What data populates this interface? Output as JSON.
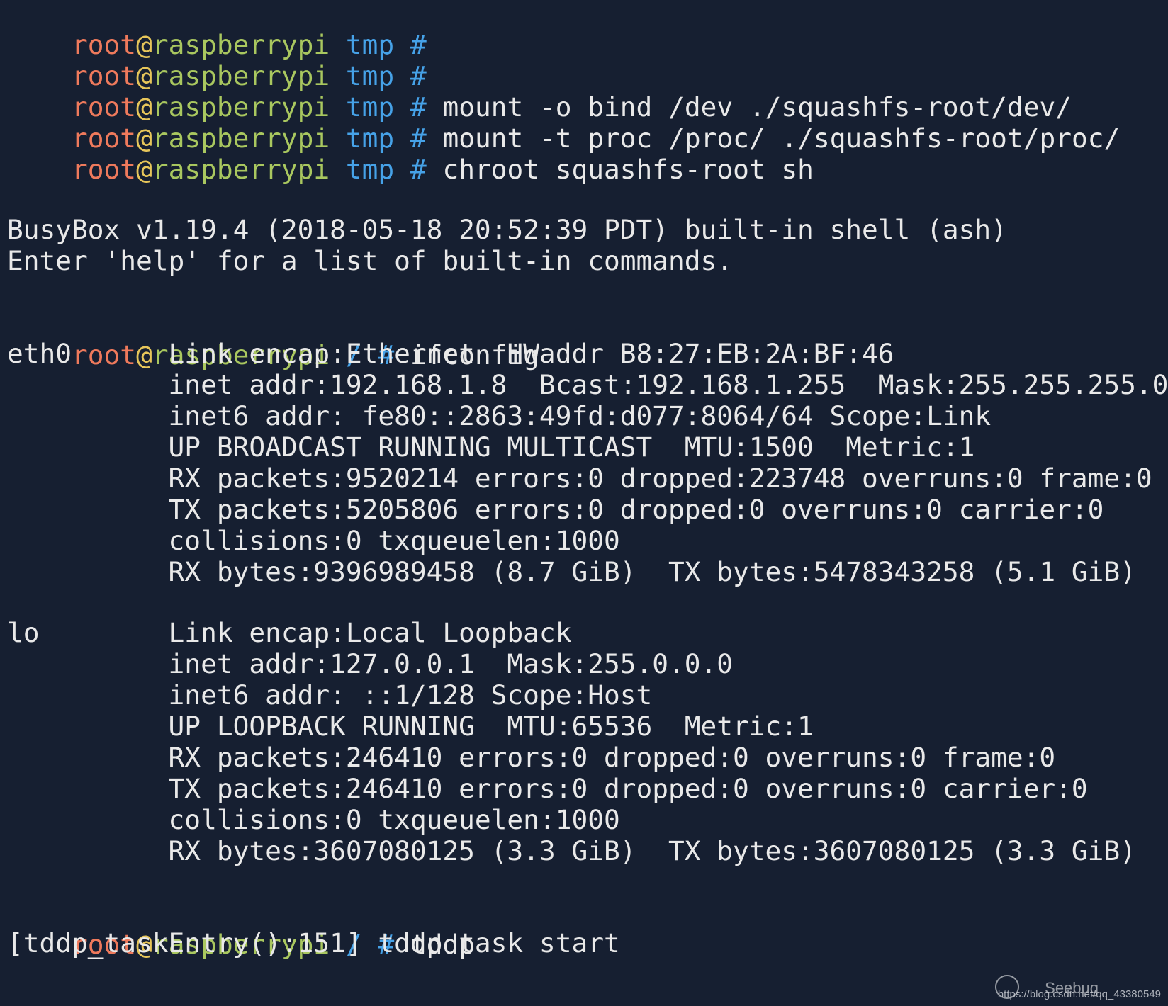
{
  "prompt": {
    "user": "root",
    "at": "@",
    "host": "raspberrypi",
    "hash": "#"
  },
  "lines": {
    "l0": {
      "dir": "tmp",
      "cmd": ""
    },
    "l1": {
      "dir": "tmp",
      "cmd": ""
    },
    "l2": {
      "dir": "tmp",
      "cmd": "mount -o bind /dev ./squashfs-root/dev/"
    },
    "l3": {
      "dir": "tmp",
      "cmd": "mount -t proc /proc/ ./squashfs-root/proc/"
    },
    "l4": {
      "dir": "tmp",
      "cmd": "chroot squashfs-root sh"
    },
    "busybox_banner": "BusyBox v1.19.4 (2018-05-18 20:52:39 PDT) built-in shell (ash)",
    "busybox_help": "Enter 'help' for a list of built-in commands.",
    "ifconfig_prompt": {
      "dir": "/",
      "cmd": "ifconfig"
    },
    "eth0": [
      "eth0      Link encap:Ethernet  HWaddr B8:27:EB:2A:BF:46",
      "          inet addr:192.168.1.8  Bcast:192.168.1.255  Mask:255.255.255.0",
      "          inet6 addr: fe80::2863:49fd:d077:8064/64 Scope:Link",
      "          UP BROADCAST RUNNING MULTICAST  MTU:1500  Metric:1",
      "          RX packets:9520214 errors:0 dropped:223748 overruns:0 frame:0",
      "          TX packets:5205806 errors:0 dropped:0 overruns:0 carrier:0",
      "          collisions:0 txqueuelen:1000",
      "          RX bytes:9396989458 (8.7 GiB)  TX bytes:5478343258 (5.1 GiB)"
    ],
    "lo": [
      "lo        Link encap:Local Loopback",
      "          inet addr:127.0.0.1  Mask:255.0.0.0",
      "          inet6 addr: ::1/128 Scope:Host",
      "          UP LOOPBACK RUNNING  MTU:65536  Metric:1",
      "          RX packets:246410 errors:0 dropped:0 overruns:0 frame:0",
      "          TX packets:246410 errors:0 dropped:0 overruns:0 carrier:0",
      "          collisions:0 txqueuelen:1000",
      "          RX bytes:3607080125 (3.3 GiB)  TX bytes:3607080125 (3.3 GiB)"
    ],
    "tddp_prompt": {
      "dir": "/",
      "cmd": "tddp"
    },
    "tddp_output": "[tddp_taskEntry():151] tddp task start"
  },
  "watermark": {
    "logo": "Seebug",
    "url": "https://blog.csdn.net/qq_43380549"
  }
}
